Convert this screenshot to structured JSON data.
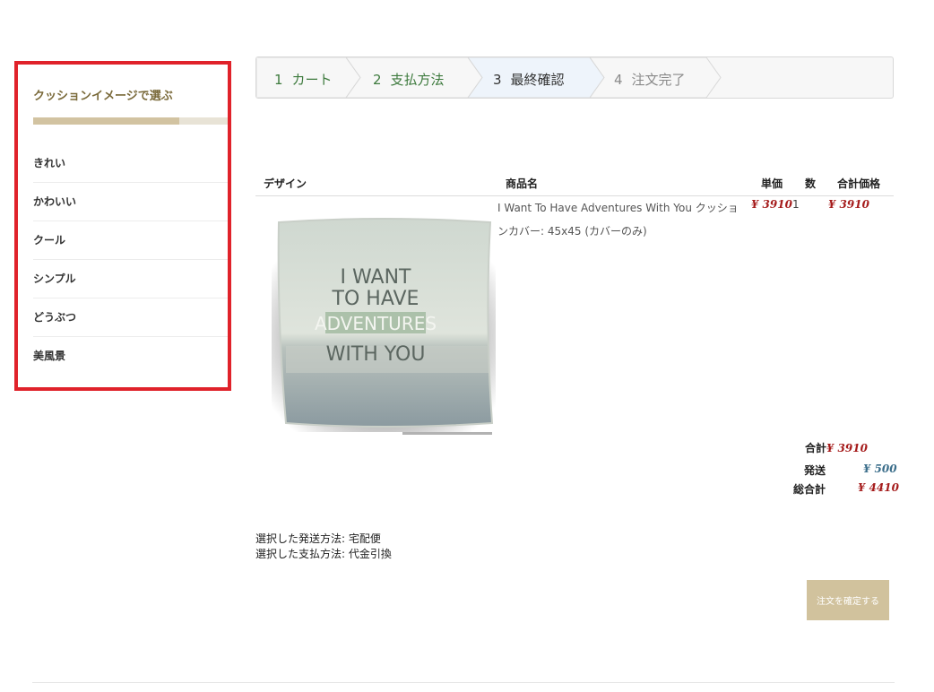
{
  "sidebar": {
    "title": "クッションイメージで選ぶ",
    "progress": 0.75,
    "items": [
      {
        "label": "きれい"
      },
      {
        "label": "かわいい"
      },
      {
        "label": "クール"
      },
      {
        "label": "シンプル"
      },
      {
        "label": "どうぶつ"
      },
      {
        "label": "美風景"
      }
    ]
  },
  "steps": [
    {
      "num": "1",
      "label": "カート",
      "state": "done"
    },
    {
      "num": "2",
      "label": "支払方法",
      "state": "done"
    },
    {
      "num": "3",
      "label": "最終確認",
      "state": "active"
    },
    {
      "num": "4",
      "label": "注文完了",
      "state": "todo"
    }
  ],
  "table": {
    "headers": {
      "design": "デザイン",
      "name": "商品名",
      "unit_price": "単価",
      "qty": "数",
      "total": "合計価格"
    },
    "item": {
      "name": "I Want To Have Adventures With You クッションカバー: 45x45 (カバーのみ)",
      "unit_price": "¥ 3910",
      "qty": "1",
      "total": "¥ 3910",
      "image_text": {
        "line1": "I WANT",
        "line2": "TO HAVE",
        "line3": "ADVENTURES",
        "line4": "WITH YOU"
      }
    }
  },
  "totals": {
    "subtotal_label": "合計",
    "subtotal": "¥ 3910",
    "shipping_label": "発送",
    "shipping": "¥ 500",
    "grand_label": "総合計",
    "grand": "¥ 4410"
  },
  "summary": {
    "shipping_method": "選択した発送方法: 宅配便",
    "payment_method": "選択した支払方法: 代金引換"
  },
  "confirm_button": "注文を確定する",
  "colors": {
    "highlight_border": "#e0222a",
    "accent": "#d1c29d",
    "price": "#a51b1b",
    "shipping": "#3a6d8a",
    "step_done": "#3d7a3d"
  }
}
